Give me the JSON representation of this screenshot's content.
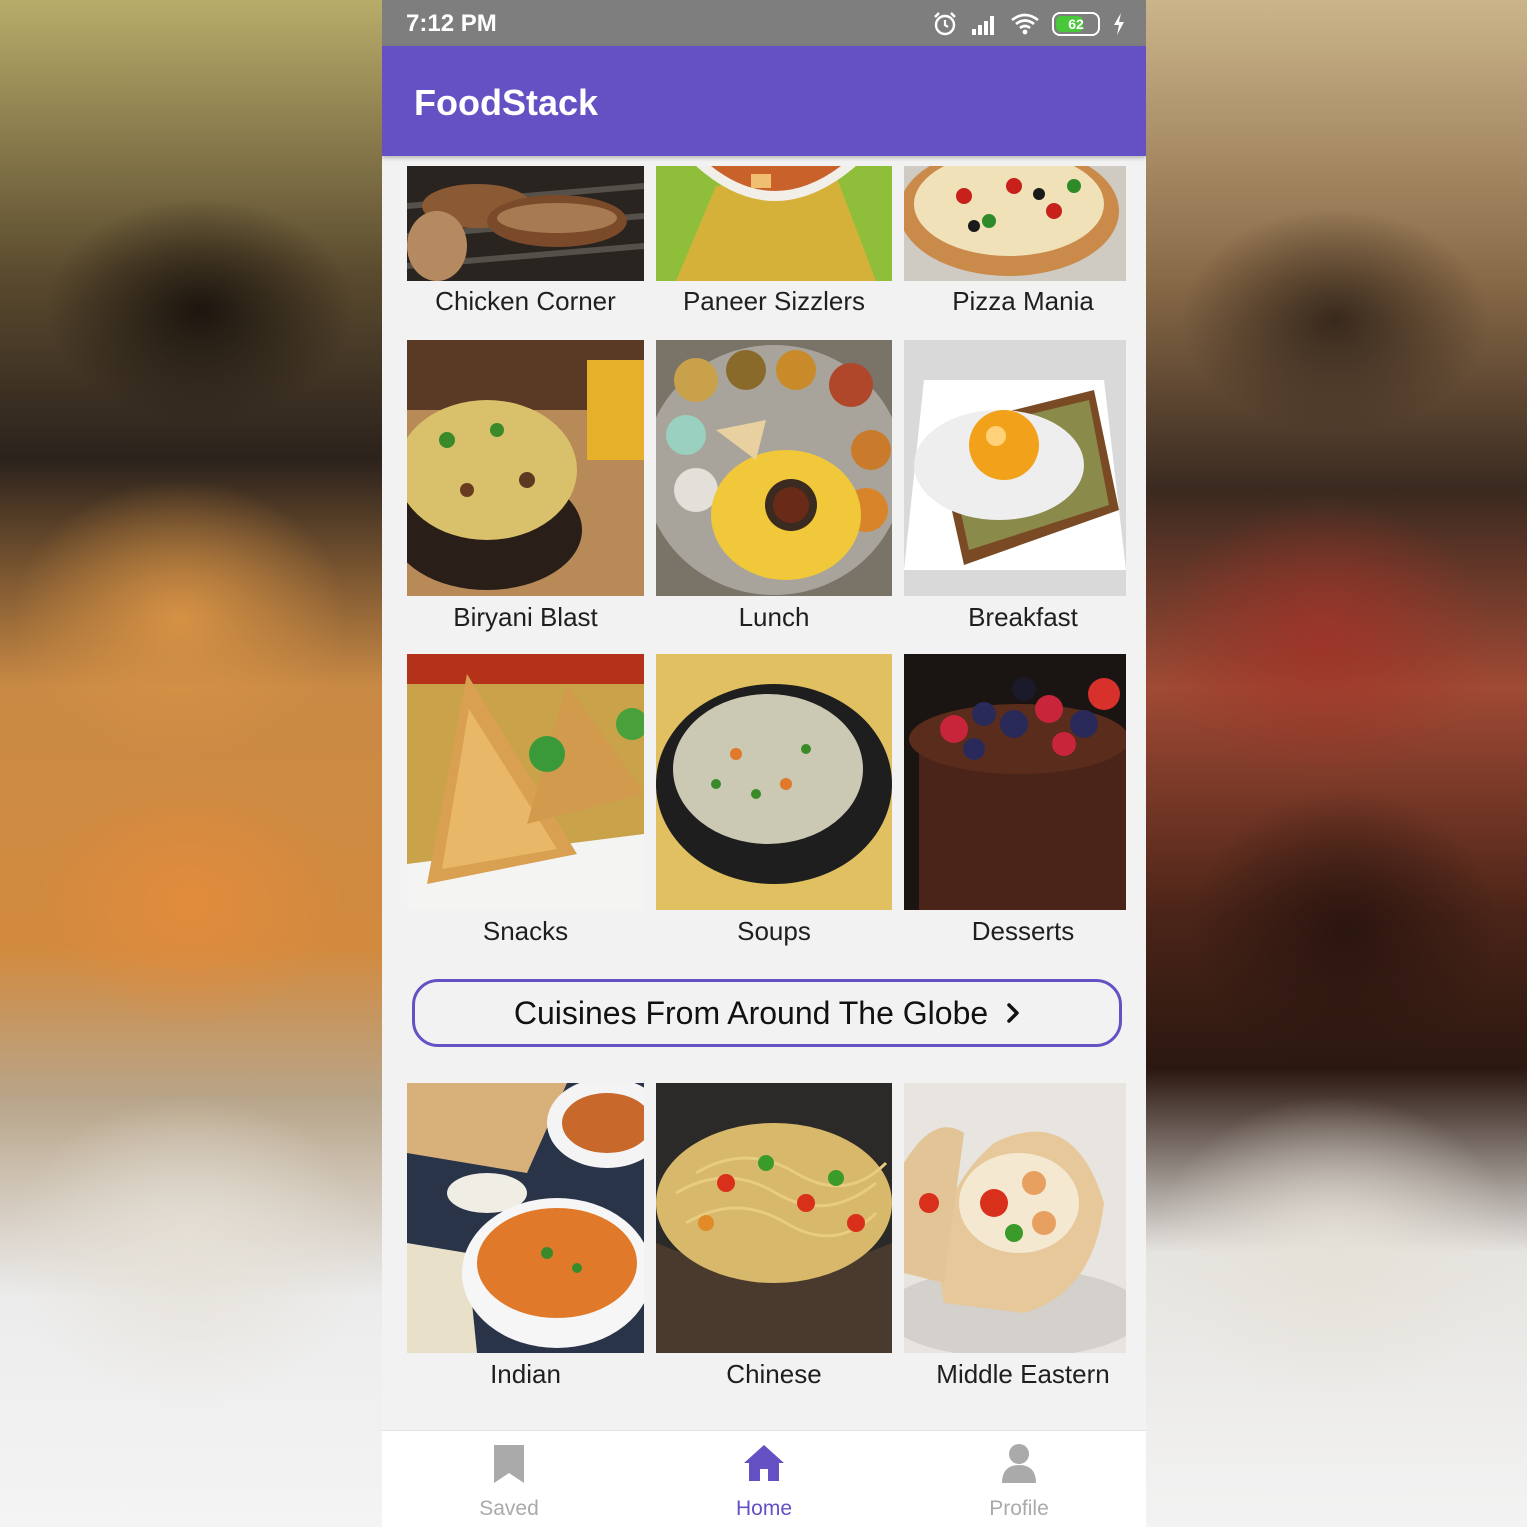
{
  "status_bar": {
    "time": "7:12 PM",
    "battery": "62",
    "icons": [
      "alarm-icon",
      "signal-icon",
      "wifi-icon",
      "battery-icon",
      "charging-icon"
    ]
  },
  "app_bar": {
    "title": "FoodStack"
  },
  "colors": {
    "primary": "#6551c4",
    "inactive": "#aaaaaa",
    "background": "#f2f2f2"
  },
  "categories": [
    {
      "label": "Chicken Corner",
      "image": "grilled-chicken-image"
    },
    {
      "label": "Paneer Sizzlers",
      "image": "paneer-curry-image"
    },
    {
      "label": "Pizza Mania",
      "image": "pizza-image"
    },
    {
      "label": "Biryani Blast",
      "image": "biryani-image"
    },
    {
      "label": "Lunch",
      "image": "thali-image"
    },
    {
      "label": "Breakfast",
      "image": "egg-toast-image"
    },
    {
      "label": "Snacks",
      "image": "samosa-image"
    },
    {
      "label": "Soups",
      "image": "soup-bowl-image"
    },
    {
      "label": "Desserts",
      "image": "chocolate-cake-image"
    }
  ],
  "globe_button": {
    "label": "Cuisines From Around The Globe"
  },
  "cuisines": [
    {
      "label": "Indian",
      "image": "indian-curry-image"
    },
    {
      "label": "Chinese",
      "image": "noodles-image"
    },
    {
      "label": "Middle Eastern",
      "image": "wrap-image"
    }
  ],
  "bottom_nav": [
    {
      "label": "Saved",
      "icon": "bookmark-icon",
      "active": false
    },
    {
      "label": "Home",
      "icon": "home-icon",
      "active": true
    },
    {
      "label": "Profile",
      "icon": "person-icon",
      "active": false
    }
  ]
}
